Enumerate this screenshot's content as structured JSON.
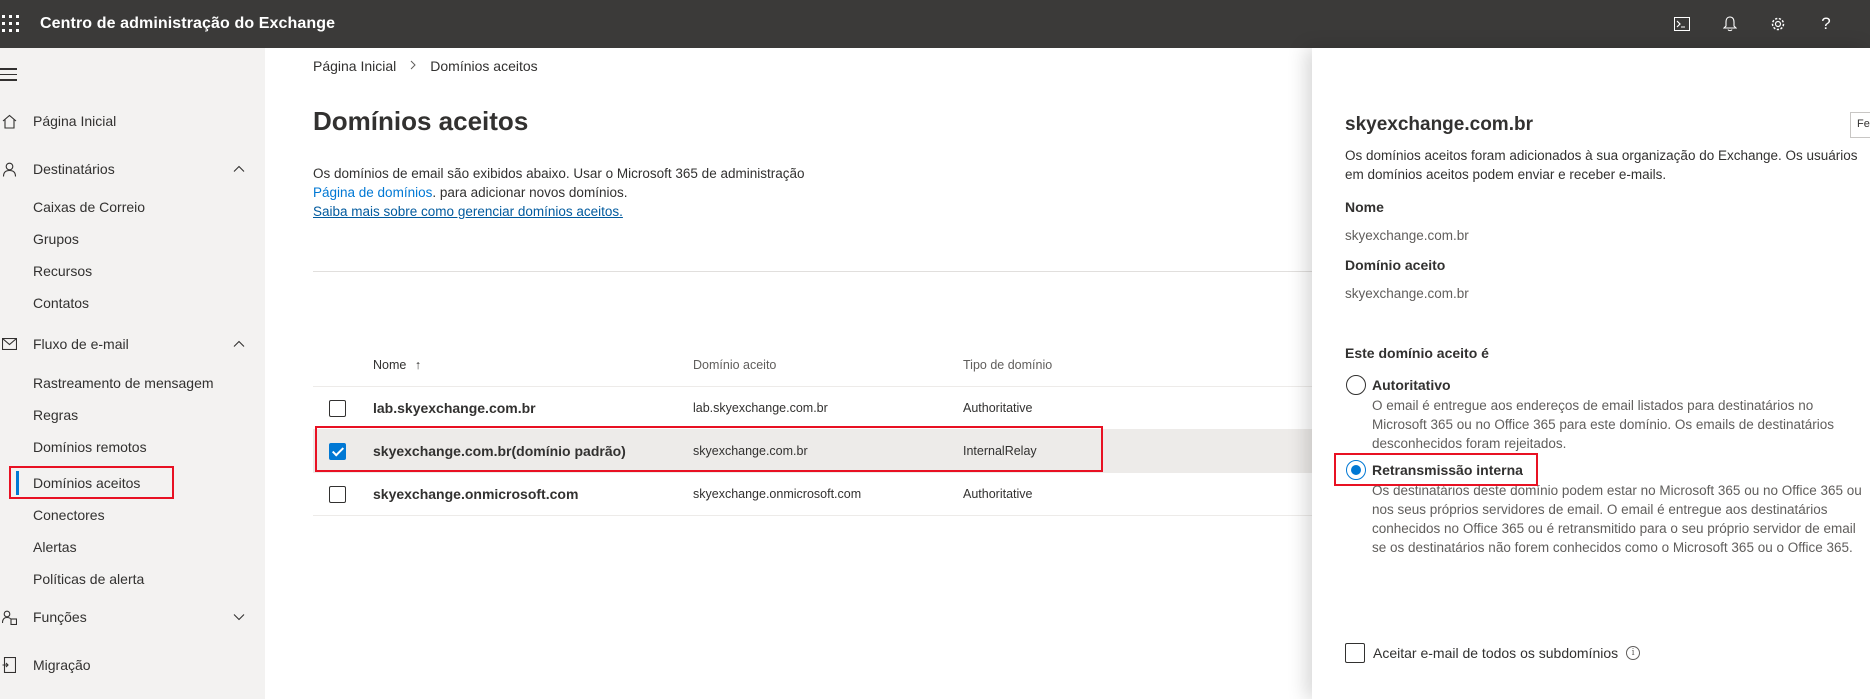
{
  "app": {
    "title": "Centro de administração do Exchange"
  },
  "topbar_icons": [
    "terminal-icon",
    "bell-icon",
    "gear-icon",
    "help-icon"
  ],
  "topbar_help_glyph": "?",
  "sidebar": {
    "home": "Página Inicial",
    "recipients": "Destinatários",
    "recipients_items": [
      "Caixas de Correio",
      "Grupos",
      "Recursos",
      "Contatos"
    ],
    "mailflow": "Fluxo de e-mail",
    "mailflow_items": [
      "Rastreamento de mensagem",
      "Regras",
      "Domínios remotos",
      "Domínios aceitos",
      "Conectores",
      "Alertas",
      "Políticas de alerta"
    ],
    "roles": "Funções",
    "migration": "Migração"
  },
  "breadcrumb": {
    "home": "Página Inicial",
    "current": "Domínios aceitos"
  },
  "page": {
    "title": "Domínios aceitos",
    "desc_line1": "Os domínios de email são exibidos abaixo. Usar o Microsoft 365 de administração",
    "desc_link": "Página de domínios",
    "desc_line2_rest": ". para adicionar novos domínios.",
    "learn_more": "Saiba mais sobre como gerenciar domínios aceitos."
  },
  "table": {
    "headers": {
      "name": "Nome",
      "sort_glyph": "↑",
      "domain": "Domínio aceito",
      "type": "Tipo de domínio"
    },
    "rows": [
      {
        "name": "lab.skyexchange.com.br",
        "domain": "lab.skyexchange.com.br",
        "type": "Authoritative",
        "selected": false
      },
      {
        "name": "skyexchange.com.br(domínio padrão)",
        "domain": "skyexchange.com.br",
        "type": "InternalRelay",
        "selected": true
      },
      {
        "name": "skyexchange.onmicrosoft.com",
        "domain": "skyexchange.onmicrosoft.com",
        "type": "Authoritative",
        "selected": false
      }
    ]
  },
  "panel": {
    "title": "skyexchange.com.br",
    "desc": "Os domínios aceitos foram adicionados à sua organização do Exchange. Os usuários em domínios aceitos podem enviar e receber e-mails.",
    "name_label": "Nome",
    "name_value": "skyexchange.com.br",
    "domain_label": "Domínio aceito",
    "domain_value": "skyexchange.com.br",
    "type_question": "Este domínio aceito é",
    "opt1_label": "Autoritativo",
    "opt1_desc": "O email é entregue aos endereços de email listados para destinatários no Microsoft 365 ou no Office 365 para este domínio. Os emails de destinatários desconhecidos foram rejeitados.",
    "opt2_label": "Retransmissão interna",
    "opt2_desc": "Os destinatários deste domínio podem estar no Microsoft 365 ou no Office 365 ou nos seus próprios servidores de email. O email é entregue aos destinatários conhecidos no Office 365 ou é retransmitido para o seu próprio servidor de email se os destinatários não forem conhecidos como o Microsoft 365 ou o Office 365.",
    "subdomains_label": "Aceitar e-mail de todos os subdomínios",
    "info_glyph": "i",
    "tooltip_text": "Fec"
  }
}
